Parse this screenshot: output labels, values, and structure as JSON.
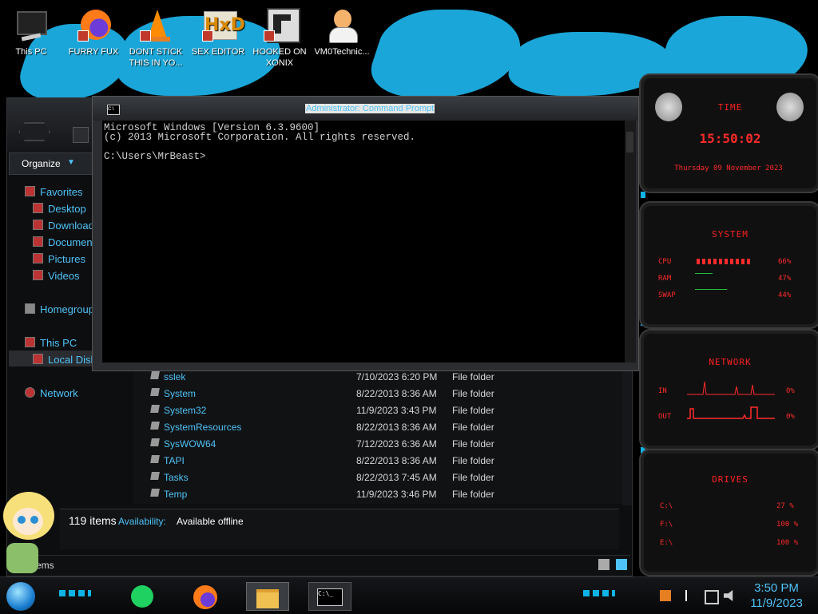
{
  "desktop": {
    "icons": [
      {
        "label": "This PC",
        "icon": "computer-icon"
      },
      {
        "label": "FURRY FUX",
        "icon": "firefox-shortcut-icon"
      },
      {
        "label": "DONT STICK THIS IN YO...",
        "icon": "vlc-cone-shortcut-icon"
      },
      {
        "label": "SEX EDITOR",
        "icon": "hxd-editor-shortcut-icon"
      },
      {
        "label": "HOOKED ON XONIX",
        "icon": "game-shortcut-icon"
      },
      {
        "label": "VM0Technic...",
        "icon": "technician-avatar-icon"
      }
    ]
  },
  "explorer": {
    "toolbar": {
      "organize_label": "Organize"
    },
    "nav": [
      {
        "label": "Favorites",
        "icon": "star-icon"
      },
      {
        "label": "Desktop",
        "icon": "desktop-icon"
      },
      {
        "label": "Downloads",
        "icon": "downloads-icon"
      },
      {
        "label": "Documents",
        "icon": "documents-icon"
      },
      {
        "label": "Pictures",
        "icon": "pictures-icon"
      },
      {
        "label": "Videos",
        "icon": "videos-icon"
      },
      {
        "label": "Homegroup",
        "icon": "homegroup-icon"
      },
      {
        "label": "This PC",
        "icon": "computer-icon"
      },
      {
        "label": "Local Disk",
        "icon": "drive-icon"
      },
      {
        "label": "Network",
        "icon": "network-icon"
      }
    ],
    "files": [
      {
        "name": "sslek",
        "date": "7/10/2023 6:20 PM",
        "type": "File folder"
      },
      {
        "name": "System",
        "date": "8/22/2013 8:36 AM",
        "type": "File folder"
      },
      {
        "name": "System32",
        "date": "11/9/2023 3:43 PM",
        "type": "File folder"
      },
      {
        "name": "SystemResources",
        "date": "8/22/2013 8:36 AM",
        "type": "File folder"
      },
      {
        "name": "SysWOW64",
        "date": "7/12/2023 6:36 AM",
        "type": "File folder"
      },
      {
        "name": "TAPI",
        "date": "8/22/2013 8:36 AM",
        "type": "File folder"
      },
      {
        "name": "Tasks",
        "date": "8/22/2013 7:45 AM",
        "type": "File folder"
      },
      {
        "name": "Temp",
        "date": "11/9/2023 3:46 PM",
        "type": "File folder"
      }
    ],
    "details": {
      "count": "119 items",
      "availability_label": "Availability:",
      "availability_value": "Available offline"
    },
    "status": {
      "text": "items"
    }
  },
  "cmd": {
    "title": "Administrator: Command Prompt",
    "lines": [
      "Microsoft Windows [Version 6.3.9600]",
      "(c) 2013 Microsoft Corporation. All rights reserved.",
      "",
      "C:\\Users\\MrBeast>"
    ]
  },
  "widgets": {
    "time": {
      "title": "TIME",
      "clock": "15:50:02",
      "date": "Thursday 09 November 2023"
    },
    "system": {
      "title": "SYSTEM",
      "cpu_label": "CPU",
      "cpu_value": "66%",
      "ram_label": "RAM",
      "ram_value": "47%",
      "swap_label": "SWAP",
      "swap_value": "44%"
    },
    "network": {
      "title": "NETWORK",
      "in_label": "IN",
      "in_value": "0%",
      "out_label": "OUT",
      "out_value": "0%"
    },
    "drives": {
      "title": "DRIVES",
      "rows": [
        {
          "label": "C:\\",
          "value": "27 %"
        },
        {
          "label": "F:\\",
          "value": "100 %"
        },
        {
          "label": "E:\\",
          "value": "100 %"
        }
      ]
    }
  },
  "taskbar": {
    "apps": [
      "notes-app-icon",
      "firefox-icon",
      "file-explorer-icon",
      "command-prompt-icon"
    ],
    "clock_time": "3:50 PM",
    "clock_date": "11/9/2023"
  },
  "colors": {
    "accent": "#4fc3f7",
    "widget_red": "#ff2a2a",
    "brush_blue": "#1aa6d8"
  }
}
